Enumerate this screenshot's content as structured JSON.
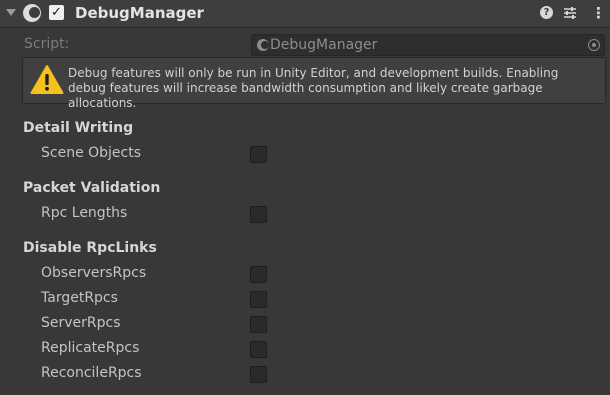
{
  "component": {
    "title": "DebugManager",
    "enabled": true,
    "icon": "unity-script-icon"
  },
  "header_icons": [
    "help-icon",
    "presets-icon",
    "menu-icon"
  ],
  "script": {
    "label": "Script:",
    "value": "DebugManager"
  },
  "warning": {
    "icon": "warning-triangle-icon",
    "text": "Debug features will only be run in Unity Editor, and development builds. Enabling debug features will increase bandwidth consumption and likely create garbage allocations."
  },
  "sections": {
    "detail_writing": {
      "title": "Detail Writing",
      "scene_objects": {
        "label": "Scene Objects",
        "checked": false
      }
    },
    "packet_validation": {
      "title": "Packet Validation",
      "rpc_lengths": {
        "label": "Rpc Lengths",
        "checked": false
      }
    },
    "disable_rpclinks": {
      "title": "Disable RpcLinks",
      "observers": {
        "label": "ObserversRpcs",
        "checked": false
      },
      "target": {
        "label": "TargetRpcs",
        "checked": false
      },
      "server": {
        "label": "ServerRpcs",
        "checked": false
      },
      "replicate": {
        "label": "ReplicateRpcs",
        "checked": false
      },
      "reconcile": {
        "label": "ReconcileRpcs",
        "checked": false
      }
    }
  },
  "colors": {
    "background": "#383838",
    "header": "#3e3e3e",
    "warning_icon": "#f4c21b"
  }
}
